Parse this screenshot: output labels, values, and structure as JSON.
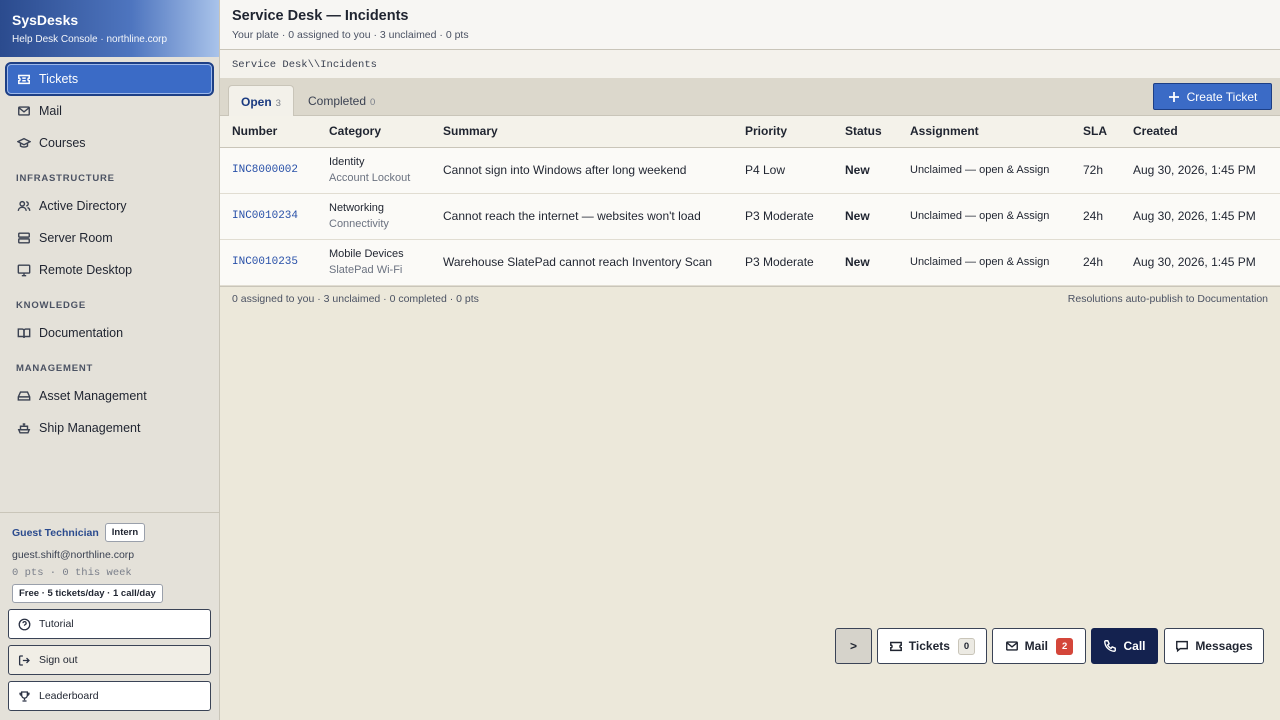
{
  "brand": {
    "title": "SysDesks",
    "subtitle": "Help Desk Console · northline.corp"
  },
  "nav": {
    "primary": [
      {
        "label": "Tickets",
        "icon": "ticket-icon",
        "active": true
      },
      {
        "label": "Mail",
        "icon": "mail-icon"
      },
      {
        "label": "Courses",
        "icon": "graduation-cap-icon"
      }
    ],
    "sections": [
      {
        "label": "INFRASTRUCTURE",
        "items": [
          {
            "label": "Active Directory",
            "icon": "users-icon"
          },
          {
            "label": "Server Room",
            "icon": "server-icon"
          },
          {
            "label": "Remote Desktop",
            "icon": "monitor-icon"
          }
        ]
      },
      {
        "label": "KNOWLEDGE",
        "items": [
          {
            "label": "Documentation",
            "icon": "book-icon"
          }
        ]
      },
      {
        "label": "MANAGEMENT",
        "items": [
          {
            "label": "Asset Management",
            "icon": "hard-drive-icon"
          },
          {
            "label": "Ship Management",
            "icon": "ship-icon"
          }
        ]
      }
    ]
  },
  "user": {
    "name": "Guest Technician",
    "role": "Intern",
    "email": "guest.shift@northline.corp",
    "points": "0 pts · 0 this week",
    "plan": "Free · 5 tickets/day · 1 call/day"
  },
  "sidebar_buttons": {
    "tutorial": "Tutorial",
    "sign_out": "Sign out",
    "leaderboard": "Leaderboard"
  },
  "header": {
    "title": "Service Desk — Incidents",
    "subtitle": "Your plate · 0 assigned to you · 3 unclaimed · 0 pts",
    "breadcrumb": "Service Desk\\\\Incidents"
  },
  "tabs": [
    {
      "label": "Open",
      "count": "3",
      "active": true
    },
    {
      "label": "Completed",
      "count": "0"
    }
  ],
  "create_button": "Create Ticket",
  "table": {
    "columns": [
      "Number",
      "Category",
      "Summary",
      "Priority",
      "Status",
      "Assignment",
      "SLA",
      "Created"
    ],
    "rows": [
      {
        "number": "INC8000002",
        "category": "Identity",
        "subcategory": "Account Lockout",
        "summary": "Cannot sign into Windows after long weekend",
        "priority": "P4 Low",
        "status": "New",
        "assignment": "Unclaimed — open & Assign",
        "sla": "72h",
        "created": "Aug 30, 2026, 1:45 PM"
      },
      {
        "number": "INC0010234",
        "category": "Networking",
        "subcategory": "Connectivity",
        "summary": "Cannot reach the internet — websites won't load",
        "priority": "P3 Moderate",
        "status": "New",
        "assignment": "Unclaimed — open & Assign",
        "sla": "24h",
        "created": "Aug 30, 2026, 1:45 PM"
      },
      {
        "number": "INC0010235",
        "category": "Mobile Devices",
        "subcategory": "SlatePad Wi-Fi",
        "summary": "Warehouse SlatePad cannot reach Inventory Scan",
        "priority": "P3 Moderate",
        "status": "New",
        "assignment": "Unclaimed — open & Assign",
        "sla": "24h",
        "created": "Aug 30, 2026, 1:45 PM"
      }
    ]
  },
  "footer": {
    "left": "0 assigned to you · 3 unclaimed · 0 completed · 0 pts",
    "right": "Resolutions auto-publish to Documentation"
  },
  "dock": {
    "toggle": ">",
    "tickets": {
      "label": "Tickets",
      "count": "0"
    },
    "mail": {
      "label": "Mail",
      "count": "2"
    },
    "call": {
      "label": "Call"
    },
    "messages": {
      "label": "Messages"
    }
  }
}
